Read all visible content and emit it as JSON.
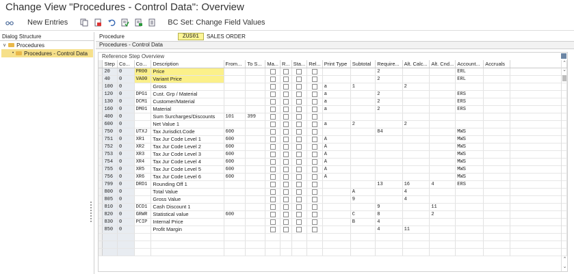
{
  "window": {
    "title": "Change View \"Procedures - Control Data\": Overview"
  },
  "toolbar": {
    "new_entries": "New Entries",
    "bc_set": "BC Set: Change Field Values"
  },
  "left_panel": {
    "header": "Dialog Structure",
    "items": [
      {
        "label": "Procedures"
      },
      {
        "label": "Procedures - Control Data"
      }
    ]
  },
  "procedure": {
    "label": "Procedure",
    "key": "ZUS01",
    "description": "SALES ORDER"
  },
  "section_title": "Procedures - Control Data",
  "grid": {
    "title": "Reference Step Overview",
    "columns": [
      "Step",
      "Co...",
      "Co...",
      "Description",
      "From...",
      "To S...",
      "Ma...",
      "R...",
      "Sta...",
      "Rel...",
      "Print Type",
      "Subtotal",
      "Require...",
      "Alt. Calc...",
      "Alt. Cnd...",
      "Account...",
      "Accruals"
    ],
    "rows": [
      {
        "step": "20",
        "cnt": "0",
        "ctyp": "PR00",
        "desc": "Price",
        "from": "",
        "to": "",
        "print": "",
        "sub": "",
        "req": "2",
        "altc": "",
        "altb": "",
        "acc": "ERL",
        "accr": ""
      },
      {
        "step": "40",
        "cnt": "0",
        "ctyp": "VA00",
        "desc": "Variant Price",
        "from": "",
        "to": "",
        "print": "",
        "sub": "",
        "req": "2",
        "altc": "",
        "altb": "",
        "acc": "ERL",
        "accr": ""
      },
      {
        "step": "100",
        "cnt": "0",
        "ctyp": "",
        "desc": "Gross",
        "from": "",
        "to": "",
        "print": "a",
        "sub": "1",
        "req": "",
        "altc": "2",
        "altb": "",
        "acc": "",
        "accr": ""
      },
      {
        "step": "120",
        "cnt": "0",
        "ctyp": "DPG1",
        "desc": "Cust. Grp / Material",
        "from": "",
        "to": "",
        "print": "a",
        "sub": "",
        "req": "2",
        "altc": "",
        "altb": "",
        "acc": "ERS",
        "accr": ""
      },
      {
        "step": "130",
        "cnt": "0",
        "ctyp": "DCM1",
        "desc": "Customer/Material",
        "from": "",
        "to": "",
        "print": "a",
        "sub": "",
        "req": "2",
        "altc": "",
        "altb": "",
        "acc": "ERS",
        "accr": ""
      },
      {
        "step": "160",
        "cnt": "0",
        "ctyp": "DM01",
        "desc": "Material",
        "from": "",
        "to": "",
        "print": "a",
        "sub": "",
        "req": "2",
        "altc": "",
        "altb": "",
        "acc": "ERS",
        "accr": ""
      },
      {
        "step": "400",
        "cnt": "0",
        "ctyp": "",
        "desc": "Sum Surcharges/Discounts",
        "from": "101",
        "to": "399",
        "print": "",
        "sub": "",
        "req": "",
        "altc": "",
        "altb": "",
        "acc": "",
        "accr": ""
      },
      {
        "step": "600",
        "cnt": "0",
        "ctyp": "",
        "desc": "Net Value 1",
        "from": "",
        "to": "",
        "print": "a",
        "sub": "2",
        "req": "",
        "altc": "2",
        "altb": "",
        "acc": "",
        "accr": ""
      },
      {
        "step": "750",
        "cnt": "0",
        "ctyp": "UTXJ",
        "desc": "Tax Jurisdict.Code",
        "from": "600",
        "to": "",
        "print": "",
        "sub": "",
        "req": "84",
        "altc": "",
        "altb": "",
        "acc": "MWS",
        "accr": ""
      },
      {
        "step": "751",
        "cnt": "0",
        "ctyp": "XR1",
        "desc": "Tax Jur Code Level 1",
        "from": "600",
        "to": "",
        "print": "A",
        "sub": "",
        "req": "",
        "altc": "",
        "altb": "",
        "acc": "MWS",
        "accr": ""
      },
      {
        "step": "752",
        "cnt": "0",
        "ctyp": "XR2",
        "desc": "Tax Jur Code Level 2",
        "from": "600",
        "to": "",
        "print": "A",
        "sub": "",
        "req": "",
        "altc": "",
        "altb": "",
        "acc": "MWS",
        "accr": ""
      },
      {
        "step": "753",
        "cnt": "0",
        "ctyp": "XR3",
        "desc": "Tax Jur Code Level 3",
        "from": "600",
        "to": "",
        "print": "A",
        "sub": "",
        "req": "",
        "altc": "",
        "altb": "",
        "acc": "MWS",
        "accr": ""
      },
      {
        "step": "754",
        "cnt": "0",
        "ctyp": "XR4",
        "desc": "Tax Jur Code Level 4",
        "from": "600",
        "to": "",
        "print": "A",
        "sub": "",
        "req": "",
        "altc": "",
        "altb": "",
        "acc": "MWS",
        "accr": ""
      },
      {
        "step": "755",
        "cnt": "0",
        "ctyp": "XR5",
        "desc": "Tax Jur Code Level 5",
        "from": "600",
        "to": "",
        "print": "A",
        "sub": "",
        "req": "",
        "altc": "",
        "altb": "",
        "acc": "MWS",
        "accr": ""
      },
      {
        "step": "756",
        "cnt": "0",
        "ctyp": "XR6",
        "desc": "Tax Jur Code Level 6",
        "from": "600",
        "to": "",
        "print": "A",
        "sub": "",
        "req": "",
        "altc": "",
        "altb": "",
        "acc": "MWS",
        "accr": ""
      },
      {
        "step": "799",
        "cnt": "0",
        "ctyp": "DRD1",
        "desc": "Rounding Off 1",
        "from": "",
        "to": "",
        "print": "",
        "sub": "",
        "req": "13",
        "altc": "16",
        "altb": "4",
        "acc": "ERS",
        "accr": ""
      },
      {
        "step": "800",
        "cnt": "0",
        "ctyp": "",
        "desc": "Total Value",
        "from": "",
        "to": "",
        "print": "",
        "sub": "A",
        "req": "",
        "altc": "4",
        "altb": "",
        "acc": "",
        "accr": ""
      },
      {
        "step": "805",
        "cnt": "0",
        "ctyp": "",
        "desc": "Gross Value",
        "from": "",
        "to": "",
        "print": "",
        "sub": "9",
        "req": "",
        "altc": "4",
        "altb": "",
        "acc": "",
        "accr": ""
      },
      {
        "step": "810",
        "cnt": "0",
        "ctyp": "DCD1",
        "desc": "Cash Discount 1",
        "from": "",
        "to": "",
        "print": "",
        "sub": "",
        "req": "9",
        "altc": "",
        "altb": "11",
        "acc": "",
        "accr": ""
      },
      {
        "step": "820",
        "cnt": "0",
        "ctyp": "GRWR",
        "desc": "Statistical value",
        "from": "600",
        "to": "",
        "print": "",
        "sub": "C",
        "req": "8",
        "altc": "",
        "altb": "2",
        "acc": "",
        "accr": ""
      },
      {
        "step": "830",
        "cnt": "0",
        "ctyp": "PCIP",
        "desc": "Internal Price",
        "from": "",
        "to": "",
        "print": "",
        "sub": "B",
        "req": "4",
        "altc": "",
        "altb": "",
        "acc": "",
        "accr": ""
      },
      {
        "step": "850",
        "cnt": "0",
        "ctyp": "",
        "desc": "Profit Margin",
        "from": "",
        "to": "",
        "print": "",
        "sub": "",
        "req": "4",
        "altc": "11",
        "altb": "",
        "acc": "",
        "accr": ""
      }
    ],
    "highlight_color": "#fbf08a"
  }
}
